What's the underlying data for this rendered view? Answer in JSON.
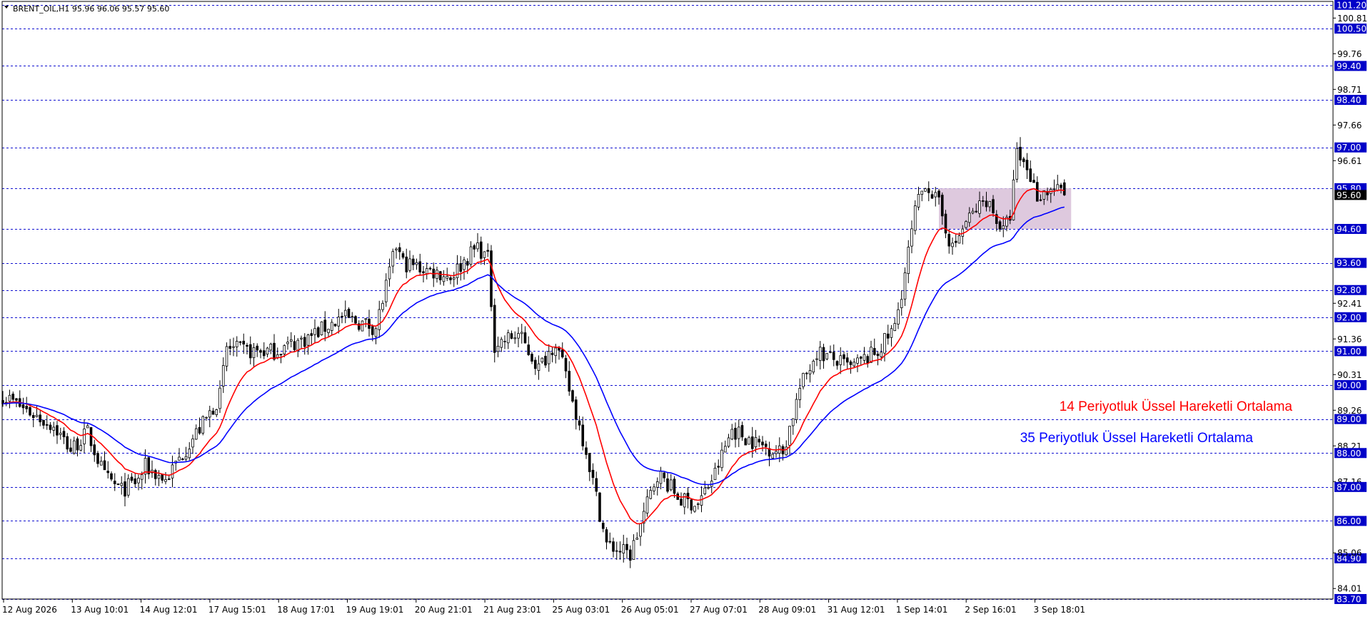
{
  "header": {
    "text": "BRENT_OIL,H1  95.96 96.06 95.57 95.60"
  },
  "colors": {
    "grid": "#1010d0",
    "ema_fast": "#ff0000",
    "ema_slow": "#0000ff",
    "zone": "#d8bfd8",
    "candle": "#000000",
    "level_label_bg": "#0000c8",
    "current_label_bg": "#000000"
  },
  "annotations": {
    "ema14": "14 Periyotluk Üssel Hareketli Ortalama",
    "ema35": "35 Periyotluk Üssel Hareketli Ortalama"
  },
  "chart_data": {
    "type": "candlestick",
    "symbol": "BRENT_OIL",
    "timeframe": "H1",
    "last_ohlc": {
      "open": 95.96,
      "high": 96.06,
      "low": 95.57,
      "close": 95.6
    },
    "current_price": "95.60",
    "ylim": [
      83.7,
      101.3
    ],
    "y_ticks": [
      "101.20",
      "100.81",
      "100.50",
      "99.76",
      "99.40",
      "98.71",
      "98.40",
      "97.66",
      "97.00",
      "96.61",
      "95.80",
      "95.60",
      "94.60",
      "93.60",
      "92.80",
      "92.41",
      "92.00",
      "91.36",
      "91.00",
      "90.31",
      "90.00",
      "89.26",
      "89.00",
      "88.21",
      "88.00",
      "87.16",
      "87.00",
      "86.00",
      "84.90",
      "85.06",
      "84.01",
      "83.70"
    ],
    "horizontal_levels": [
      "101.20",
      "100.50",
      "99.40",
      "98.40",
      "97.00",
      "95.80",
      "94.60",
      "93.60",
      "92.80",
      "92.00",
      "91.00",
      "90.00",
      "89.00",
      "88.00",
      "87.00",
      "86.00",
      "84.90",
      "83.70"
    ],
    "x_ticks": [
      "12 Aug 2026",
      "13 Aug 10:01",
      "14 Aug 12:01",
      "17 Aug 15:01",
      "18 Aug 17:01",
      "19 Aug 19:01",
      "20 Aug 21:01",
      "21 Aug 23:01",
      "25 Aug 03:01",
      "26 Aug 05:01",
      "27 Aug 07:01",
      "28 Aug 09:01",
      "31 Aug 12:01",
      "1 Sep 14:01",
      "2 Sep 16:01",
      "3 Sep 18:01"
    ],
    "zone": {
      "low": 94.6,
      "high": 95.8,
      "from_index": 276,
      "to_index": 315
    },
    "price_anchors": [
      [
        0,
        89.7
      ],
      [
        8,
        89.2
      ],
      [
        15,
        88.8
      ],
      [
        20,
        88.1
      ],
      [
        25,
        88.6
      ],
      [
        30,
        87.3
      ],
      [
        35,
        86.9
      ],
      [
        40,
        87.2
      ],
      [
        42,
        87.6
      ],
      [
        45,
        87.4
      ],
      [
        48,
        87.2
      ],
      [
        55,
        88.3
      ],
      [
        60,
        89.0
      ],
      [
        64,
        89.7
      ],
      [
        66,
        91.1
      ],
      [
        72,
        91.0
      ],
      [
        80,
        91.0
      ],
      [
        90,
        91.4
      ],
      [
        100,
        92.0
      ],
      [
        110,
        91.7
      ],
      [
        116,
        94.1
      ],
      [
        118,
        93.6
      ],
      [
        125,
        93.4
      ],
      [
        132,
        93.2
      ],
      [
        140,
        94.1
      ],
      [
        143,
        93.7
      ],
      [
        145,
        91.2
      ],
      [
        152,
        91.5
      ],
      [
        158,
        90.5
      ],
      [
        163,
        91.3
      ],
      [
        168,
        89.5
      ],
      [
        172,
        88.1
      ],
      [
        178,
        85.3
      ],
      [
        185,
        85.0
      ],
      [
        190,
        86.5
      ],
      [
        193,
        87.4
      ],
      [
        196,
        87.1
      ],
      [
        200,
        86.6
      ],
      [
        205,
        86.5
      ],
      [
        210,
        87.4
      ],
      [
        215,
        88.7
      ],
      [
        222,
        88.3
      ],
      [
        230,
        88.0
      ],
      [
        235,
        89.9
      ],
      [
        240,
        91.0
      ],
      [
        250,
        90.5
      ],
      [
        258,
        91.0
      ],
      [
        263,
        91.7
      ],
      [
        266,
        93.3
      ],
      [
        269,
        95.1
      ],
      [
        272,
        96.0
      ],
      [
        276,
        95.3
      ],
      [
        280,
        94.0
      ],
      [
        284,
        94.8
      ],
      [
        290,
        95.5
      ],
      [
        295,
        94.5
      ],
      [
        297,
        95.0
      ],
      [
        299,
        96.8
      ],
      [
        302,
        96.4
      ],
      [
        305,
        95.6
      ],
      [
        310,
        95.8
      ],
      [
        313,
        95.6
      ]
    ],
    "series": [
      {
        "name": "14 Periyotluk Üssel Hareketli Ortalama",
        "type": "ema",
        "period": 14
      },
      {
        "name": "35 Periyotluk Üssel Hareketli Ortalama",
        "type": "ema",
        "period": 35
      }
    ]
  }
}
